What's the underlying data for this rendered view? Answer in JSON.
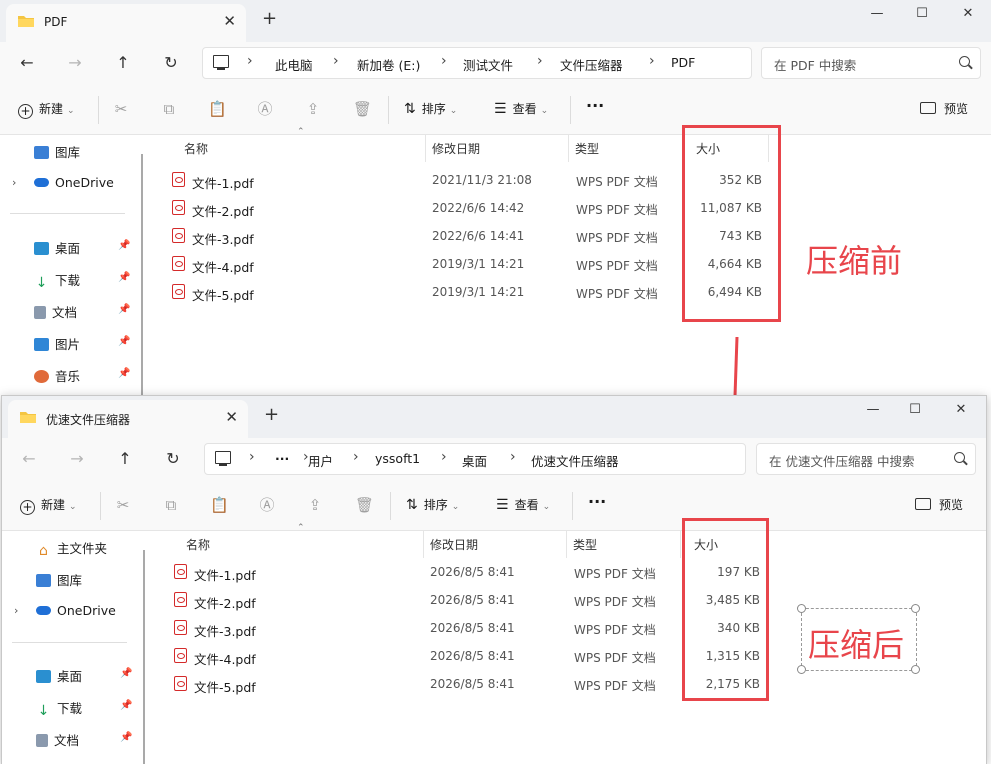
{
  "window1": {
    "tab_title": "PDF",
    "path": [
      "此电脑",
      "新加卷 (E:)",
      "测试文件",
      "文件压缩器",
      "PDF"
    ],
    "search_placeholder": "在 PDF 中搜索",
    "sidebar": [
      {
        "label": "图库",
        "icon": "gallery-icon"
      },
      {
        "label": "OneDrive",
        "icon": "onedrive-icon"
      },
      {
        "label": "桌面",
        "icon": "desktop-icon"
      },
      {
        "label": "下载",
        "icon": "download-icon"
      },
      {
        "label": "文档",
        "icon": "documents-icon"
      },
      {
        "label": "图片",
        "icon": "pictures-icon"
      },
      {
        "label": "音乐",
        "icon": "music-icon"
      }
    ],
    "files": [
      {
        "name": "文件-1.pdf",
        "date": "2021/11/3 21:08",
        "type": "WPS PDF 文档",
        "size": "352 KB"
      },
      {
        "name": "文件-2.pdf",
        "date": "2022/6/6 14:42",
        "type": "WPS PDF 文档",
        "size": "11,087 KB"
      },
      {
        "name": "文件-3.pdf",
        "date": "2022/6/6 14:41",
        "type": "WPS PDF 文档",
        "size": "743 KB"
      },
      {
        "name": "文件-4.pdf",
        "date": "2019/3/1 14:21",
        "type": "WPS PDF 文档",
        "size": "4,664 KB"
      },
      {
        "name": "文件-5.pdf",
        "date": "2019/3/1 14:21",
        "type": "WPS PDF 文档",
        "size": "6,494 KB"
      }
    ]
  },
  "window2": {
    "tab_title": "优速文件压缩器",
    "path": [
      "用户",
      "yssoft1",
      "桌面",
      "优速文件压缩器"
    ],
    "search_placeholder": "在 优速文件压缩器 中搜索",
    "sidebar": [
      {
        "label": "主文件夹",
        "icon": "home-icon"
      },
      {
        "label": "图库",
        "icon": "gallery-icon"
      },
      {
        "label": "OneDrive",
        "icon": "onedrive-icon"
      },
      {
        "label": "桌面",
        "icon": "desktop-icon"
      },
      {
        "label": "下载",
        "icon": "download-icon"
      },
      {
        "label": "文档",
        "icon": "documents-icon"
      }
    ],
    "files": [
      {
        "name": "文件-1.pdf",
        "date": "2026/8/5 8:41",
        "type": "WPS PDF 文档",
        "size": "197 KB"
      },
      {
        "name": "文件-2.pdf",
        "date": "2026/8/5 8:41",
        "type": "WPS PDF 文档",
        "size": "3,485 KB"
      },
      {
        "name": "文件-3.pdf",
        "date": "2026/8/5 8:41",
        "type": "WPS PDF 文档",
        "size": "340 KB"
      },
      {
        "name": "文件-4.pdf",
        "date": "2026/8/5 8:41",
        "type": "WPS PDF 文档",
        "size": "1,315 KB"
      },
      {
        "name": "文件-5.pdf",
        "date": "2026/8/5 8:41",
        "type": "WPS PDF 文档",
        "size": "2,175 KB"
      }
    ]
  },
  "toolbar": {
    "new": "新建",
    "sort": "排序",
    "view": "查看",
    "more": "···",
    "preview": "预览"
  },
  "columns": {
    "name": "名称",
    "date": "修改日期",
    "type": "类型",
    "size": "大小"
  },
  "annotations": {
    "before": "压缩前",
    "after": "压缩后",
    "color": "#e8454b"
  },
  "ellipsis": "···"
}
